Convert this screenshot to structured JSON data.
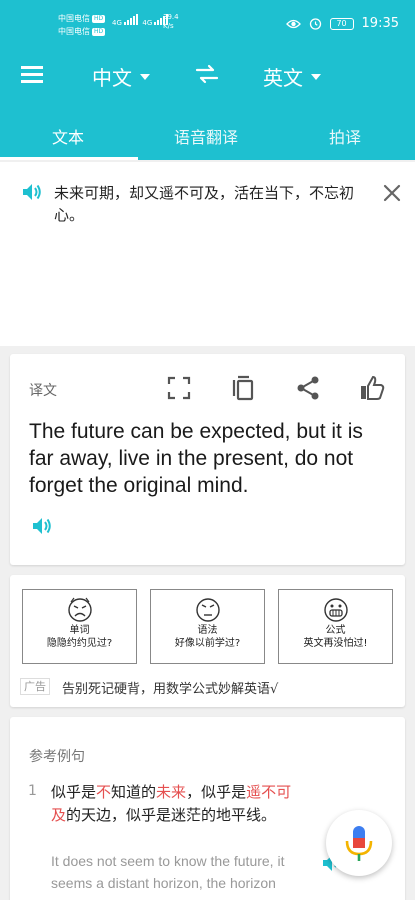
{
  "status_bar": {
    "carrier_1": "中国电信",
    "carrier_2": "中国电信",
    "hd_badge": "HD",
    "network_1": "4G",
    "network_2": "4G",
    "speed_value": "39.4",
    "speed_unit": "K/s",
    "battery": "70",
    "time": "19:35"
  },
  "app_bar": {
    "source_language": "中文",
    "target_language": "英文",
    "tabs": [
      {
        "label": "文本",
        "active": true
      },
      {
        "label": "语音翻译",
        "active": false
      },
      {
        "label": "拍译",
        "active": false
      }
    ]
  },
  "source": {
    "text": "未来可期，却又遥不可及，活在当下，不忘初心。"
  },
  "result": {
    "label": "译文",
    "text": "The future can be expected, but it is far away, live in the present, do not forget the original mind."
  },
  "ad": {
    "tiles": [
      {
        "line1": "单词",
        "line2": "隐隐约约见过?"
      },
      {
        "line1": "语法",
        "line2": "好像以前学过?"
      },
      {
        "line1": "公式",
        "line2": "英文再没怕过!"
      }
    ],
    "badge": "广告",
    "text": "告别死记硬背，用数学公式妙解英语√"
  },
  "examples": {
    "title": "参考例句",
    "items": [
      {
        "number": "1",
        "cn_parts": [
          {
            "t": "似乎是",
            "hl": false
          },
          {
            "t": "不",
            "hl": true
          },
          {
            "t": "知道的",
            "hl": false
          },
          {
            "t": "未来",
            "hl": true
          },
          {
            "t": "，似乎是",
            "hl": false
          },
          {
            "t": "遥不可及",
            "hl": true
          },
          {
            "t": "的天边，似乎是迷茫的地平线。",
            "hl": false
          }
        ],
        "en": "It does not seem to know the future, it seems a distant horizon, the horizon seems to be confused"
      }
    ]
  },
  "colors": {
    "primary": "#1ec0d0",
    "highlight": "#e55050"
  }
}
